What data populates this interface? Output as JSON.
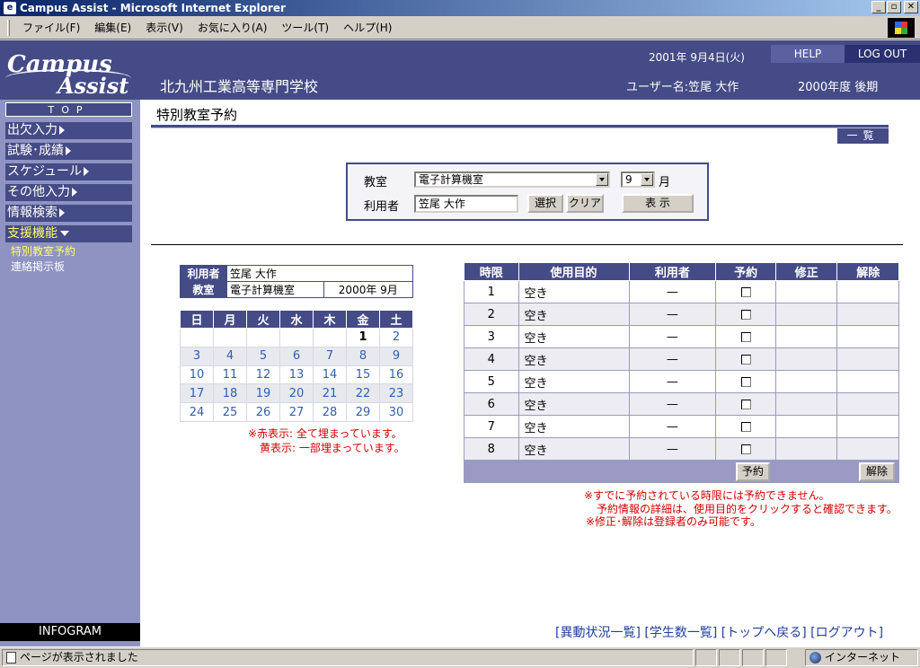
{
  "window": {
    "title": "Campus Assist - Microsoft Internet Explorer",
    "controls": [
      "_",
      "▫",
      "✕"
    ]
  },
  "menu": [
    "ファイル(F)",
    "編集(E)",
    "表示(V)",
    "お気に入り(A)",
    "ツール(T)",
    "ヘルプ(H)"
  ],
  "header": {
    "logo_line1": "Campus",
    "logo_line2": "Assist",
    "school": "北九州工業高等専門学校",
    "date": "2001年 9月4日(火)",
    "help": "HELP",
    "logout": "LOG OUT",
    "username": "ユーザー名:笠尾 大作",
    "term": "2000年度 後期"
  },
  "sidebar": {
    "top": "TOP",
    "items": [
      "出欠入力",
      "試験･成績",
      "スケジュール",
      "その他入力",
      "情報検索",
      "支援機能"
    ],
    "subitems": [
      "特別教室予約",
      "連絡掲示板"
    ],
    "infogram": "INFOGRAM"
  },
  "main": {
    "title": "特別教室予約",
    "list_button": "一覧"
  },
  "search": {
    "room_label": "教室",
    "room_value": "電子計算機室",
    "month_value": "9",
    "month_label": "月",
    "user_label": "利用者",
    "user_value": "笠尾 大作",
    "select_btn": "選択",
    "clear_btn": "クリア",
    "show_btn": "表 示"
  },
  "info": {
    "user_label": "利用者",
    "user_value": "笠尾 大作",
    "room_label": "教室",
    "room_value": "電子計算機室",
    "period": "2000年 9月"
  },
  "calendar": {
    "weekdays": [
      "日",
      "月",
      "火",
      "水",
      "木",
      "金",
      "土"
    ],
    "weeks": [
      [
        "",
        "",
        "",
        "",
        "",
        "1",
        "2"
      ],
      [
        "3",
        "4",
        "5",
        "6",
        "7",
        "8",
        "9"
      ],
      [
        "10",
        "11",
        "12",
        "13",
        "14",
        "15",
        "16"
      ],
      [
        "17",
        "18",
        "19",
        "20",
        "21",
        "22",
        "23"
      ],
      [
        "24",
        "25",
        "26",
        "27",
        "28",
        "29",
        "30"
      ]
    ],
    "note1": "※赤表示: 全て埋まっています。",
    "note2": "黄表示: 一部埋まっています。"
  },
  "reservations": {
    "headers": [
      "時限",
      "使用目的",
      "利用者",
      "予約",
      "修正",
      "解除"
    ],
    "rows": [
      {
        "period": "1",
        "purpose": "空き",
        "user": "—"
      },
      {
        "period": "2",
        "purpose": "空き",
        "user": "—"
      },
      {
        "period": "3",
        "purpose": "空き",
        "user": "—"
      },
      {
        "period": "4",
        "purpose": "空き",
        "user": "—"
      },
      {
        "period": "5",
        "purpose": "空き",
        "user": "—"
      },
      {
        "period": "6",
        "purpose": "空き",
        "user": "—"
      },
      {
        "period": "7",
        "purpose": "空き",
        "user": "—"
      },
      {
        "period": "8",
        "purpose": "空き",
        "user": "—"
      }
    ],
    "reserve_btn": "予約",
    "cancel_btn": "解除",
    "note1": "※すでに予約されている時限には予約できません。",
    "note2": "予約情報の詳細は、使用目的をクリックすると確認できます。",
    "note3": "※修正･解除は登録者のみ可能です。"
  },
  "footer": {
    "links": [
      "[異動状況一覧]",
      "[学生数一覧]",
      "[トップへ戻る]",
      "[ログアウト]"
    ]
  },
  "status": {
    "message": "ページが表示されました",
    "zone": "インターネット"
  }
}
